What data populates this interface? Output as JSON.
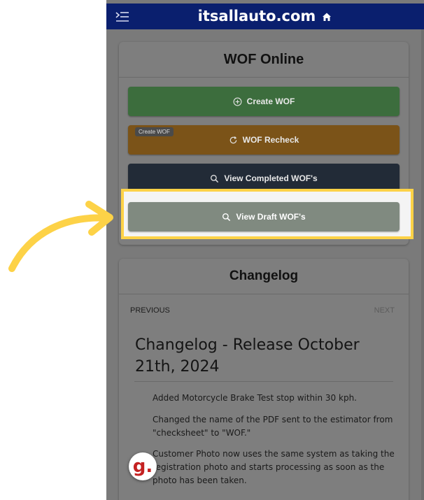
{
  "header": {
    "brand": "itsallauto.com",
    "menu_icon": "menu-collapse-icon",
    "home_icon": "home-icon"
  },
  "wof_card": {
    "title": "WOF Online",
    "buttons": {
      "create": "Create WOF",
      "recheck": "WOF Recheck",
      "completed": "View Completed WOF's",
      "draft": "View Draft WOF's"
    },
    "tooltip": "Create WOF"
  },
  "changelog": {
    "title": "Changelog",
    "previous": "PREVIOUS",
    "next": "NEXT",
    "release_title": "Changelog - Release October 21th, 2024",
    "paragraphs": [
      "Added Motorcycle Brake Test stop within 30 kph.",
      "Changed the name of the PDF sent to the estimator from \"checksheet\" to \"WOF.\"",
      "Customer Photo now uses the same system as taking the registration photo and starts processing as soon as the photo has been taken."
    ]
  },
  "badge": {
    "letter": "g."
  },
  "colors": {
    "header": "#0a1f6e",
    "create": "#3c6d3d",
    "recheck": "#7b5318",
    "completed": "#222b37",
    "draft": "#808a80",
    "highlight": "#fdd247"
  }
}
